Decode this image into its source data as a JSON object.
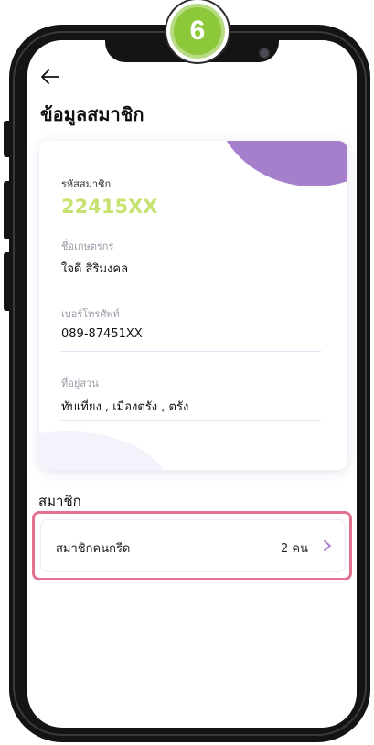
{
  "step_badge": "6",
  "header": {
    "title": "ข้อมูลสมาชิก",
    "back_icon": "arrow-left-icon"
  },
  "profile": {
    "member_id_label": "รหัสสมาชิก",
    "member_id_value": "22415XX",
    "farmer_name_label": "ชื่อเกษตรกร",
    "farmer_name_value": "ใจดี สิริมงคล",
    "phone_label": "เบอร์โทรศัพท์",
    "phone_value": "089-87451XX",
    "address_label": "ที่อยู่สวน",
    "address_value": "ทับเที่ยง , เมืองตรัง , ตรัง"
  },
  "members_section": {
    "title": "สมาชิก",
    "row_label": "สมาชิกคนกรีด",
    "row_count": "2 คน",
    "chevron_icon": "chevron-right-icon"
  },
  "colors": {
    "accent_green": "#c5e36e",
    "accent_purple": "#a57fcb",
    "highlight_pink": "#e2728f",
    "field_underline": "#e6def2"
  }
}
